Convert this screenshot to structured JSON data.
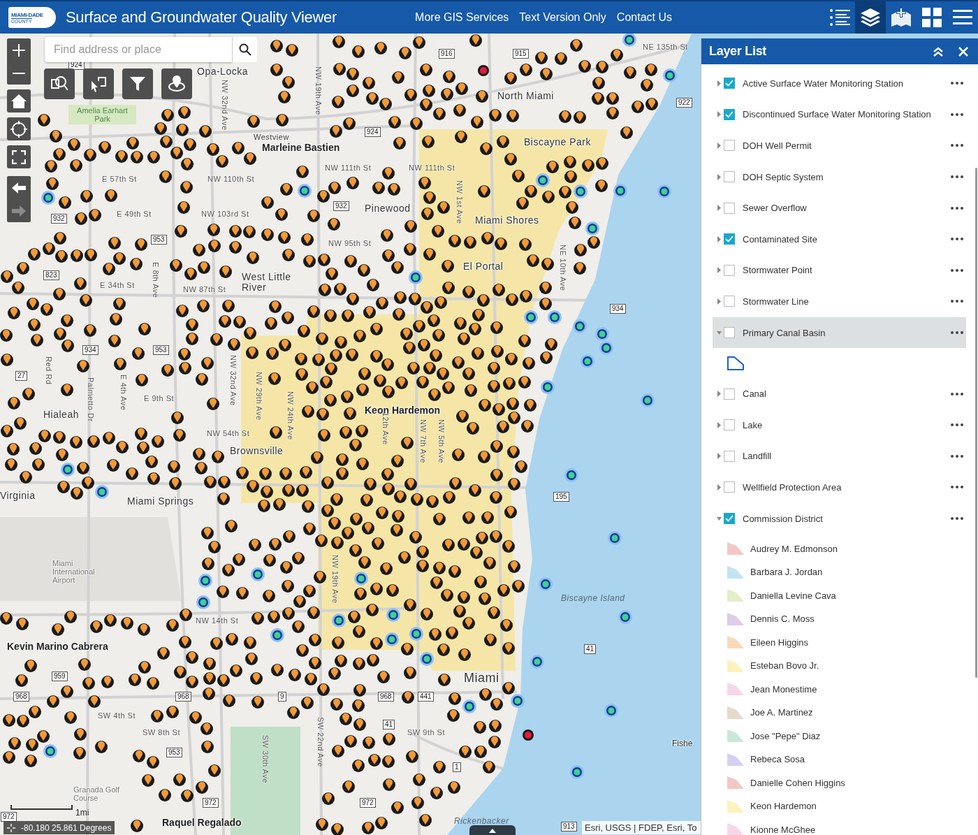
{
  "header": {
    "logo": {
      "line1": "MIAMI-DADE",
      "line2": "COUNTY"
    },
    "title": "Surface and Groundwater Quality Viewer",
    "links": [
      "More GIS Services",
      "Text Version Only",
      "Contact Us"
    ],
    "tools": [
      {
        "kind": "list",
        "selected": false
      },
      {
        "kind": "layers",
        "selected": true
      },
      {
        "kind": "add-data",
        "selected": false
      },
      {
        "kind": "grid",
        "selected": false
      },
      {
        "kind": "menu",
        "selected": false
      }
    ]
  },
  "map": {
    "search": {
      "placeholder": "Find address or place"
    },
    "nav": [
      {
        "kind": "back",
        "disabled": false
      },
      {
        "kind": "forward",
        "disabled": true
      }
    ],
    "place_labels": [
      "Opa-Locka",
      "North Miami",
      "Amelia Earhart Park",
      "Westview",
      "Marleine Bastien",
      "Biscayne Park",
      "Pinewood",
      "Miami Shores",
      "El Portal",
      "West Little River",
      "Hialeah",
      "Keon Hardemon",
      "Brownsville",
      "Virginia",
      "Miami Springs",
      "Miami International Airport",
      "Biscayne Island",
      "Kevin Marino Cabrera",
      "Miami",
      "Fishe",
      "Granada Golf Course",
      "Raquel Regalado",
      "Rickenbacker"
    ],
    "street_labels": [
      "NE 135th St",
      "NW 111th St",
      "NW 111th St",
      "E 57th St",
      "NW 110th St",
      "E 49th St",
      "NW 103rd St",
      "NW 95th St",
      "E 34th St",
      "NW 87th St",
      "E 9th St",
      "NW 54th St",
      "NW 14th St",
      "SW 4th St",
      "SW 8th St",
      "SW 9th St"
    ],
    "avenue_labels": [
      "NW 32nd Ave",
      "NW 19th Ave",
      "NW 1st Ave",
      "E 8th Ave",
      "NE 10th Ave",
      "Red Rd",
      "Palmetto Dr",
      "E 4th Ave",
      "NW 32nd Ave",
      "NW 29th Ave",
      "NW 24th Ave",
      "12th Ave",
      "NW 7th Ave",
      "NW 5th Ave",
      "NW 19th Ave",
      "SW 30th Ave",
      "SW 22nd Ave"
    ],
    "route_shields": [
      "916",
      "915",
      "924",
      "922",
      "924",
      "932",
      "932",
      "953",
      "823",
      "934",
      "934",
      "953",
      "27",
      "195",
      "41",
      "959",
      "968",
      "968",
      "9",
      "968",
      "441",
      "41",
      "953",
      "1",
      "972",
      "972",
      "972",
      "913"
    ],
    "scale": "1mi",
    "coordinates": "-80.180 25.861 Degrees",
    "attribution": "Esri, USGS | FDEP, Esri, To"
  },
  "layer_list": {
    "title": "Layer List",
    "layers": [
      {
        "label": "Active Surface Water Monitoring Station",
        "checked": true,
        "expanded": false,
        "selected": false
      },
      {
        "label": "Discontinued Surface Water Monitoring Station",
        "checked": true,
        "expanded": false,
        "selected": false
      },
      {
        "label": "DOH Well Permit",
        "checked": false,
        "expanded": false,
        "selected": false
      },
      {
        "label": "DOH Septic System",
        "checked": false,
        "expanded": false,
        "selected": false
      },
      {
        "label": "Sewer Overflow",
        "checked": false,
        "expanded": false,
        "selected": false
      },
      {
        "label": "Contaminated Site",
        "checked": true,
        "expanded": false,
        "selected": false
      },
      {
        "label": "Stormwater Point",
        "checked": false,
        "expanded": false,
        "selected": false
      },
      {
        "label": "Stormwater Line",
        "checked": false,
        "expanded": false,
        "selected": false
      },
      {
        "label": "Primary Canal Basin",
        "checked": false,
        "expanded": true,
        "selected": true,
        "legend": [
          {
            "kind": "outline",
            "color": "#1f5fd0"
          }
        ]
      },
      {
        "label": "Canal",
        "checked": false,
        "expanded": false,
        "selected": false
      },
      {
        "label": "Lake",
        "checked": false,
        "expanded": false,
        "selected": false
      },
      {
        "label": "Landfill",
        "checked": false,
        "expanded": false,
        "selected": false
      },
      {
        "label": "Wellfield Protection Area",
        "checked": false,
        "expanded": false,
        "selected": false
      },
      {
        "label": "Commission District",
        "checked": true,
        "expanded": true,
        "selected": false,
        "legend": [
          {
            "kind": "fill",
            "label": "Audrey M. Edmonson",
            "color": "#f5c6c6"
          },
          {
            "kind": "fill",
            "label": "Barbara J. Jordan",
            "color": "#c2e3f2"
          },
          {
            "kind": "fill",
            "label": "Daniella Levine Cava",
            "color": "#e4edc8"
          },
          {
            "kind": "fill",
            "label": "Dennis C. Moss",
            "color": "#dfcce8"
          },
          {
            "kind": "fill",
            "label": "Eileen Higgins",
            "color": "#fad9ba"
          },
          {
            "kind": "fill",
            "label": "Esteban Bovo Jr.",
            "color": "#fcf2bd"
          },
          {
            "kind": "fill",
            "label": "Jean Monestime",
            "color": "#f8d6ea"
          },
          {
            "kind": "fill",
            "label": "Joe A. Martinez",
            "color": "#e6dacb"
          },
          {
            "kind": "fill",
            "label": "Jose \"Pepe\" Diaz",
            "color": "#c9e8da"
          },
          {
            "kind": "fill",
            "label": "Rebeca Sosa",
            "color": "#d5d0f2"
          },
          {
            "kind": "fill",
            "label": "Danielle Cohen Higgins",
            "color": "#f5c6c6"
          },
          {
            "kind": "fill",
            "label": "Keon Hardemon",
            "color": "#fcf2bd"
          },
          {
            "kind": "fill",
            "label": "Kionne McGhee",
            "color": "#f8d6ea"
          }
        ]
      }
    ]
  }
}
